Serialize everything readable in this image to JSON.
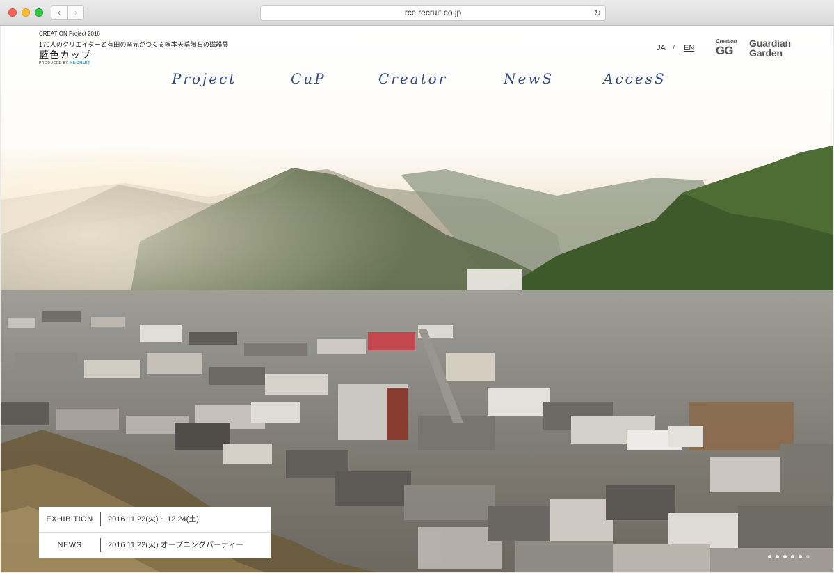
{
  "browser": {
    "url": "rcc.recruit.co.jp",
    "back_glyph": "‹",
    "forward_glyph": "›",
    "reload_glyph": "↻"
  },
  "header": {
    "project_label": "CREATION Project 2016",
    "subtitle": "170人のクリエイターと有田の窯元がつくる熊本天草陶石の磁器展",
    "title": "藍色カップ",
    "produced_by": "PRODUCED BY",
    "produced_brand": "RECRUIT",
    "lang_ja": "JA",
    "lang_sep": "/",
    "lang_en": "EN",
    "logo_cg_line1": "Creation",
    "logo_cg_line2": "GG",
    "logo_gg_line1": "Guardian",
    "logo_gg_line2": "Garden"
  },
  "nav": {
    "project": "Project",
    "cup": "CuP",
    "creator": "Creator",
    "news": "NewS",
    "access": "AccesS"
  },
  "info": {
    "exhibition_label": "EXHIBITION",
    "exhibition_value": "2016.11.22(火) ~ 12.24(土)",
    "news_label": "NEWS",
    "news_value": "2016.11.22(火) オープニングパーティー"
  },
  "slider": {
    "count": 6,
    "active": 5
  }
}
